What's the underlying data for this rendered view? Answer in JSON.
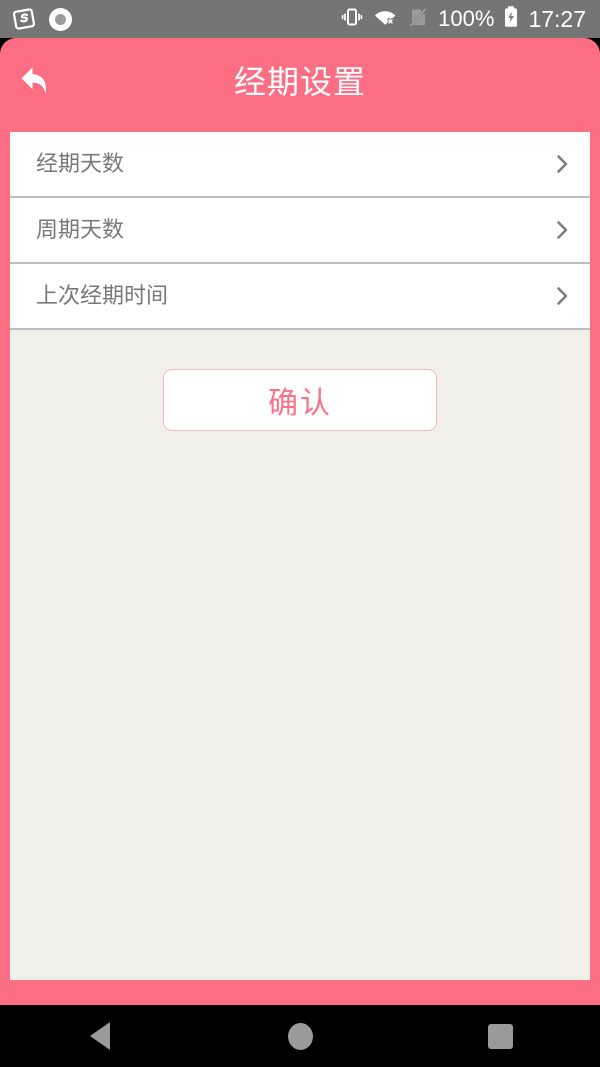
{
  "status_bar": {
    "left_icons": [
      {
        "name": "sogou-input-icon",
        "glyph": "S"
      },
      {
        "name": "screen-recorder-icon",
        "glyph": "◉"
      }
    ],
    "right_icons": [
      {
        "name": "vibrate-icon"
      },
      {
        "name": "wifi-off-icon"
      },
      {
        "name": "no-sim-icon"
      }
    ],
    "battery_percent": "100%",
    "battery_state": "charging",
    "clock": "17:27",
    "background_color": "#757575"
  },
  "header": {
    "title": "经期设置",
    "back_icon": "back-arrow-icon",
    "background_color": "#fc6e84",
    "title_color": "#ffffff"
  },
  "settings": {
    "rows": [
      {
        "label": "经期天数",
        "value": "",
        "chevron": "chevron-right-icon"
      },
      {
        "label": "周期天数",
        "value": "",
        "chevron": "chevron-right-icon"
      },
      {
        "label": "上次经期时间",
        "value": "",
        "chevron": "chevron-right-icon"
      }
    ],
    "row_label_color": "#787878",
    "row_background": "#ffffff"
  },
  "confirm_button": {
    "label": "确认",
    "text_color": "#fa7287",
    "border_color": "#f5b3bf",
    "background": "#ffffff"
  },
  "content": {
    "background_color": "#f0efe8"
  },
  "nav_bar": {
    "buttons": [
      {
        "name": "nav-back-button",
        "shape": "triangle"
      },
      {
        "name": "nav-home-button",
        "shape": "circle"
      },
      {
        "name": "nav-recents-button",
        "shape": "square"
      }
    ],
    "background_color": "#000000",
    "icon_color": "#9a9a9a"
  }
}
